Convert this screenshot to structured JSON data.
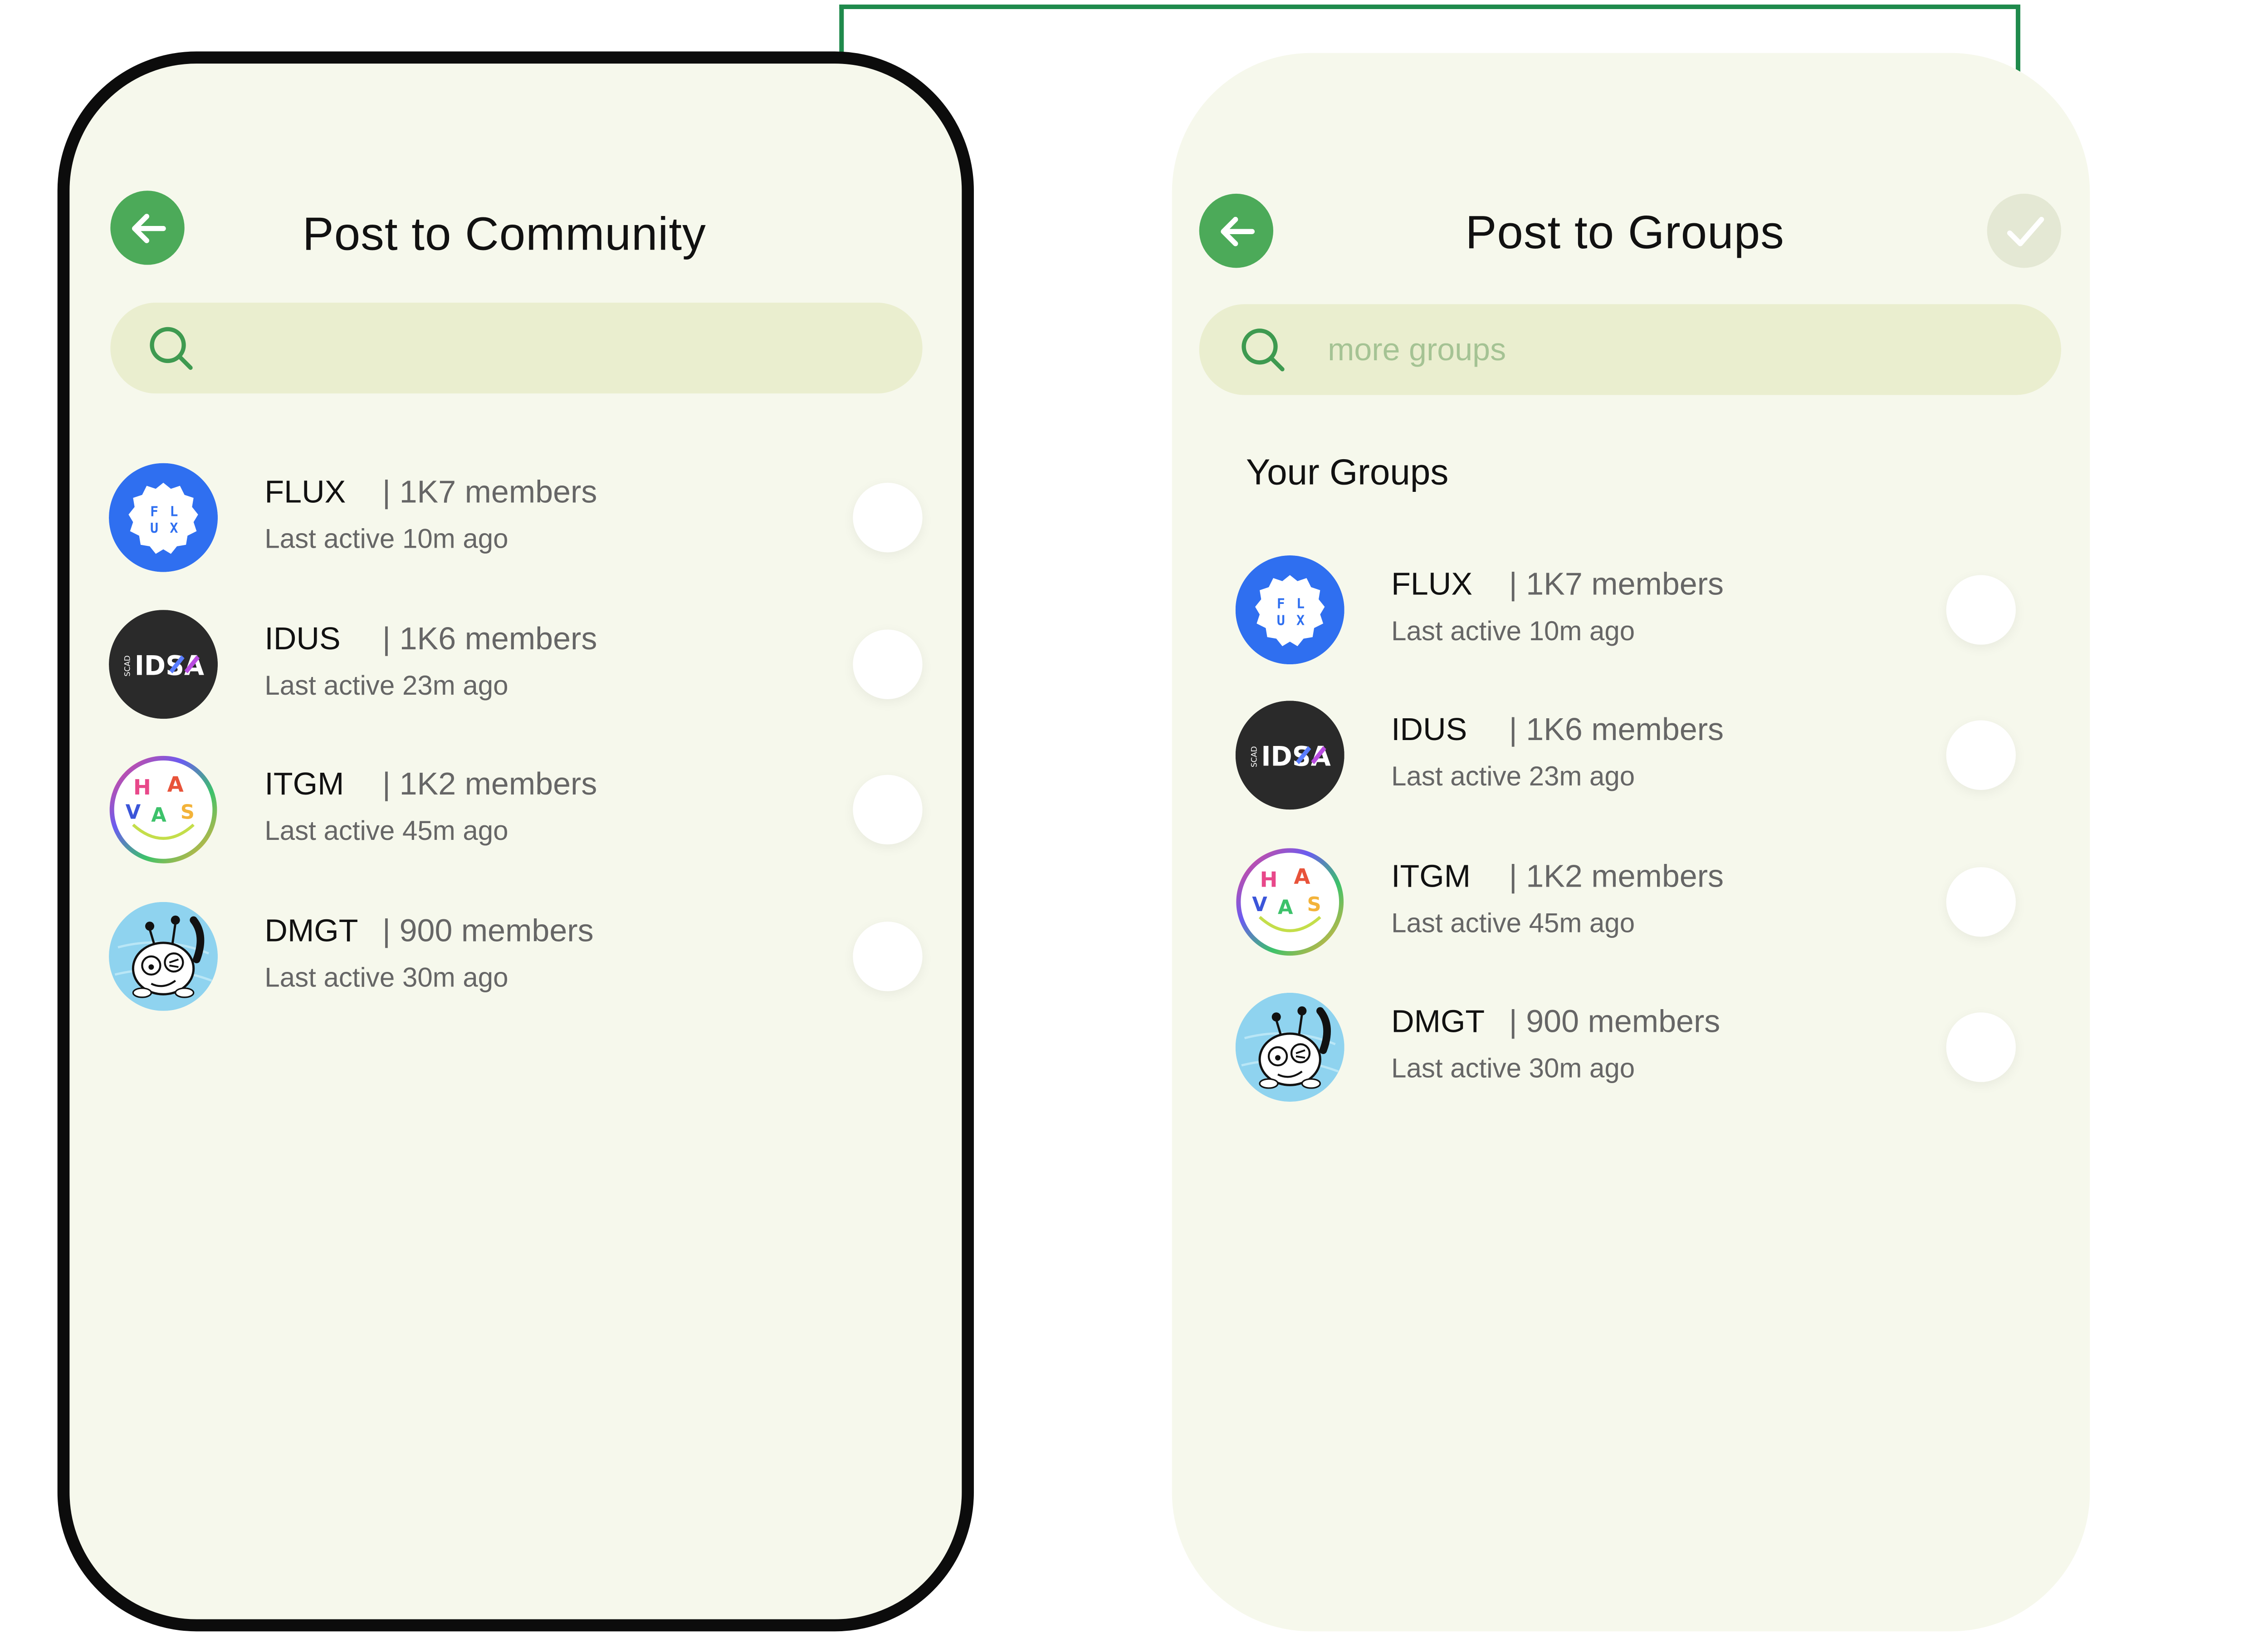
{
  "colors": {
    "accent_green": "#4caa59",
    "connector_green": "#1f8a4c",
    "panel_bg": "#f6f8ec",
    "search_bg": "#eaeecf",
    "flux_blue": "#2f6ff0",
    "idus_dark": "#2a2a2a",
    "dmgt_sky": "#8fd3ef"
  },
  "left": {
    "title": "Post to Community",
    "back_icon": "arrow-left-icon",
    "search": {
      "icon": "search-icon",
      "placeholder": ""
    },
    "groups": [
      {
        "name": "FLUX",
        "members": "| 1K7 members",
        "active": "Last active 10m ago"
      },
      {
        "name": "IDUS",
        "members": "| 1K6 members",
        "active": "Last active 23m ago"
      },
      {
        "name": "ITGM",
        "members": "| 1K2 members",
        "active": "Last active 45m ago"
      },
      {
        "name": "DMGT",
        "members": "| 900 members",
        "active": "Last active 30m ago"
      }
    ]
  },
  "right": {
    "title": "Post to Groups",
    "back_icon": "arrow-left-icon",
    "confirm_icon": "checkmark-icon",
    "search": {
      "icon": "search-icon",
      "placeholder": "more groups"
    },
    "section_title": "Your Groups",
    "groups": [
      {
        "name": "FLUX",
        "members": "| 1K7 members",
        "active": "Last active 10m ago"
      },
      {
        "name": "IDUS",
        "members": "| 1K6 members",
        "active": "Last active 23m ago"
      },
      {
        "name": "ITGM",
        "members": "| 1K2 members",
        "active": "Last active 45m ago"
      },
      {
        "name": "DMGT",
        "members": "| 900 members",
        "active": "Last active 30m ago"
      }
    ]
  },
  "avatars": {
    "flux": {
      "letters": [
        "F",
        "L",
        "U",
        "X"
      ]
    },
    "idus": {
      "side_text": "SCAD",
      "text": "IDSA"
    },
    "itgm": {
      "letters": [
        "H",
        "A",
        "V",
        "A",
        "S"
      ]
    }
  }
}
